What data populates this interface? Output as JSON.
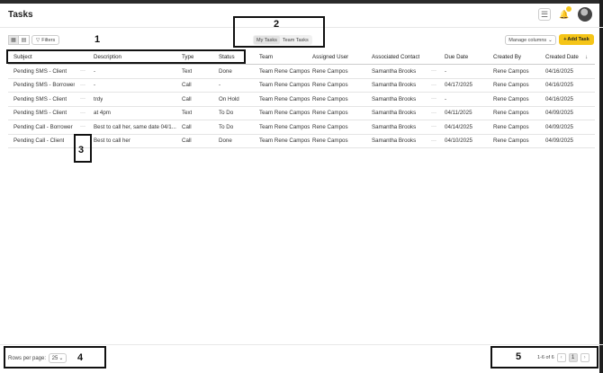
{
  "header": {
    "title": "Tasks"
  },
  "toolbar": {
    "filters_label": "Filters",
    "tabs": [
      {
        "label": "My Tasks",
        "active": true
      },
      {
        "label": "Team Tasks",
        "active": false
      }
    ],
    "manage_columns_label": "Manage columns",
    "add_task_label": "Add Task"
  },
  "table": {
    "columns": [
      "Subject",
      "Description",
      "Type",
      "Status",
      "Team",
      "Assigned User",
      "Associated Contact",
      "Due Date",
      "Created By",
      "Created Date"
    ],
    "rows": [
      [
        "Pending SMS - Client",
        "-",
        "Text",
        "Done",
        "Team Rene Campos",
        "Rene Campos",
        "Samantha Brooks",
        "-",
        "Rene Campos",
        "04/16/2025"
      ],
      [
        "Pending SMS - Borrower",
        "-",
        "Call",
        "-",
        "Team Rene Campos",
        "Rene Campos",
        "Samantha Brooks",
        "04/17/2025",
        "Rene Campos",
        "04/16/2025"
      ],
      [
        "Pending SMS - Client",
        "trdy",
        "Call",
        "On Hold",
        "Team Rene Campos",
        "Rene Campos",
        "Samantha Brooks",
        "-",
        "Rene Campos",
        "04/16/2025"
      ],
      [
        "Pending SMS - Client",
        "at 4pm",
        "Text",
        "To Do",
        "Team Rene Campos",
        "Rene Campos",
        "Samantha Brooks",
        "04/11/2025",
        "Rene Campos",
        "04/09/2025"
      ],
      [
        "Pending Call - Borrower",
        "Best to call her, same date 04/1...",
        "Call",
        "To Do",
        "Team Rene Campos",
        "Rene Campos",
        "Samantha Brooks",
        "04/14/2025",
        "Rene Campos",
        "04/09/2025"
      ],
      [
        "Pending Call - Client",
        "Best to call her",
        "Call",
        "Done",
        "Team Rene Campos",
        "Rene Campos",
        "Samantha Brooks",
        "04/10/2025",
        "Rene Campos",
        "04/09/2025"
      ]
    ]
  },
  "footer": {
    "rows_per_page_label": "Rows per page:",
    "rows_per_page_value": "25",
    "range_label": "1-6 of 6",
    "current_page": "1"
  },
  "annotations": [
    "1",
    "2",
    "3",
    "4",
    "5"
  ]
}
